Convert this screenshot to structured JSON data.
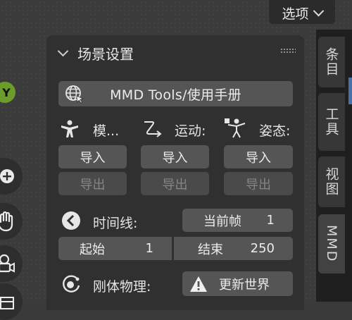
{
  "options_dropdown": {
    "label": "选项"
  },
  "toolbar": {
    "nav_axis_label": "Y"
  },
  "panel": {
    "title": "场景设置",
    "manual_button": "MMD Tools/使用手册",
    "columns": [
      {
        "label": "模...",
        "import": "导入",
        "export": "导出"
      },
      {
        "label": "运动:",
        "import": "导入",
        "export": "导出"
      },
      {
        "label": "姿态:",
        "import": "导入",
        "export": "导出"
      }
    ],
    "timeline": {
      "label": "时间线:",
      "current_frame_label": "当前帧",
      "current_frame_value": "1",
      "start_label": "起始",
      "start_value": "1",
      "end_label": "结束",
      "end_value": "250"
    },
    "rigid_body": {
      "label": "刚体物理:",
      "update_button": "更新世界"
    }
  },
  "sidebar_tabs": [
    "条目",
    "工具",
    "视图",
    "MMD"
  ]
}
